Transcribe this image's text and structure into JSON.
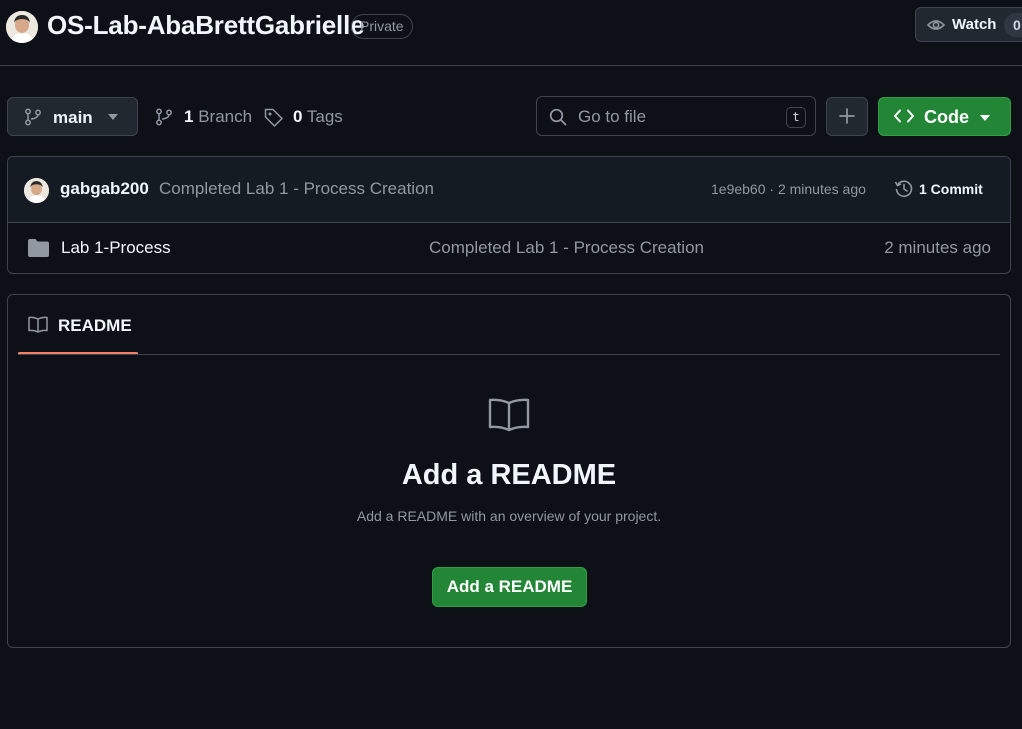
{
  "header": {
    "repo_name": "OS-Lab-AbaBrettGabrielle",
    "visibility_badge": "Private",
    "watch_label": "Watch",
    "watch_count": "0"
  },
  "toolbar": {
    "branch_name": "main",
    "branches_count": "1",
    "branches_label": "Branch",
    "tags_count": "0",
    "tags_label": "Tags",
    "search_placeholder": "Go to file",
    "search_shortcut": "t",
    "code_label": "Code"
  },
  "latest_commit": {
    "author": "gabgab200",
    "message": "Completed Lab 1 - Process Creation",
    "hash_and_time": "1e9eb60 · 2 minutes ago",
    "commit_count_label": "1 Commit"
  },
  "files": [
    {
      "name": "Lab 1-Process",
      "type": "folder",
      "commit_message": "Completed Lab 1 - Process Creation",
      "age": "2 minutes ago"
    }
  ],
  "readme": {
    "tab_label": "README",
    "empty_title": "Add a README",
    "empty_subtitle": "Add a README with an overview of your project.",
    "add_button_label": "Add a README"
  },
  "icons": {
    "avatar": "user-avatar",
    "eye": "eye-icon",
    "branch": "git-branch-icon",
    "tag": "tag-icon",
    "search": "search-icon",
    "plus": "plus-icon",
    "code": "code-icon",
    "caret": "caret-down-icon",
    "history": "history-icon",
    "folder": "folder-icon",
    "book": "book-icon"
  },
  "colors": {
    "background": "#0d1117",
    "accent_green": "#238636",
    "tab_underline": "#f78166",
    "muted_text": "#9198a1"
  }
}
